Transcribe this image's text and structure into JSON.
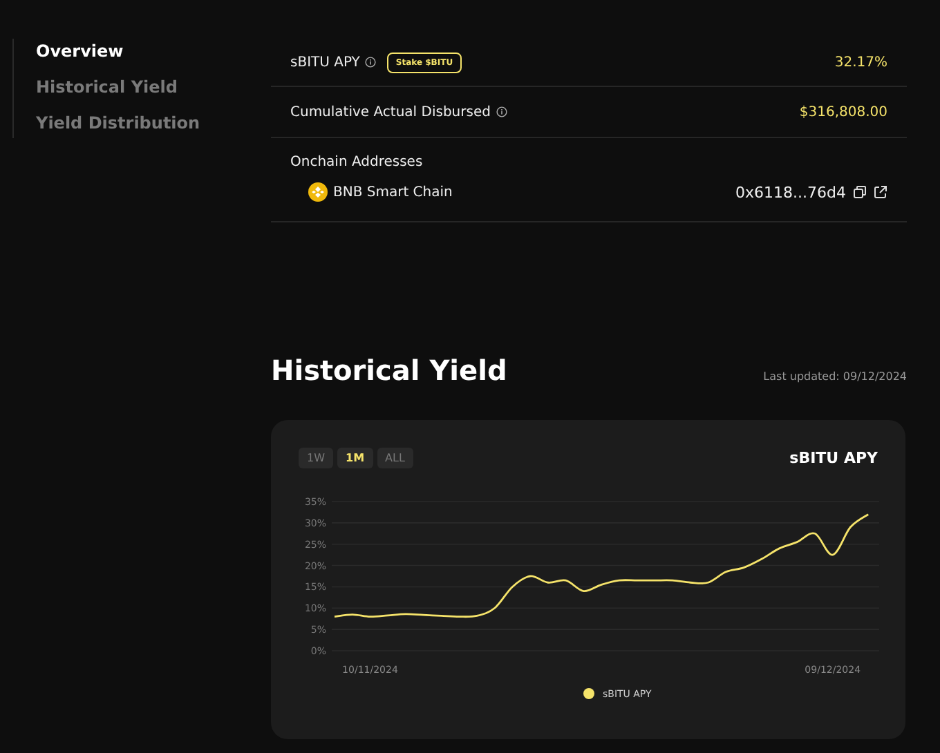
{
  "sidebar": {
    "items": [
      {
        "label": "Overview",
        "selected": true
      },
      {
        "label": "Historical Yield",
        "selected": false
      },
      {
        "label": "Yield Distribution",
        "selected": false
      }
    ]
  },
  "overview": {
    "rows": [
      {
        "label": "sBITU APY",
        "info": true,
        "button": "Stake $BITU",
        "value": "32.17%"
      },
      {
        "label": "Cumulative Actual Disbursed",
        "info": true,
        "value": "$316,808.00"
      }
    ],
    "addresses": {
      "title": "Onchain Addresses",
      "items": [
        {
          "chain": "BNB Smart Chain",
          "address": "0x6118...76d4"
        }
      ]
    }
  },
  "historical": {
    "title": "Historical Yield",
    "last_updated": "Last updated: 09/12/2024",
    "ranges": [
      {
        "label": "1W",
        "selected": false
      },
      {
        "label": "1M",
        "selected": true
      },
      {
        "label": "ALL",
        "selected": false
      }
    ],
    "chart_title": "sBITU APY",
    "chart_data": {
      "type": "line",
      "categories": [
        null,
        null,
        "10/11/2024",
        null,
        null,
        null,
        null,
        null,
        null,
        null,
        null,
        null,
        null,
        null,
        null,
        null,
        null,
        null,
        null,
        null,
        null,
        null,
        null,
        null,
        null,
        null,
        null,
        null,
        "09/12/2024",
        null,
        null
      ],
      "series": [
        {
          "name": "sBITU APY",
          "color": "#f5e36a",
          "values": [
            8,
            8.5,
            8,
            8.3,
            8.6,
            8.4,
            8.2,
            8,
            8.2,
            10,
            15,
            17.5,
            16,
            16.5,
            14,
            15.5,
            16.5,
            16.5,
            16.5,
            16.5,
            16,
            16,
            18.5,
            19.5,
            21.5,
            24,
            25.5,
            27.5,
            22.5,
            29,
            32
          ]
        }
      ],
      "ylim": [
        0,
        35
      ],
      "grid": true,
      "yticks": [
        {
          "value": 0,
          "label": "0%"
        },
        {
          "value": 5,
          "label": "5%"
        },
        {
          "value": 10,
          "label": "10%"
        },
        {
          "value": 15,
          "label": "15%"
        },
        {
          "value": 20,
          "label": "20%"
        },
        {
          "value": 25,
          "label": "25%"
        },
        {
          "value": 30,
          "label": "30%"
        },
        {
          "value": 35,
          "label": "35%"
        }
      ]
    }
  }
}
